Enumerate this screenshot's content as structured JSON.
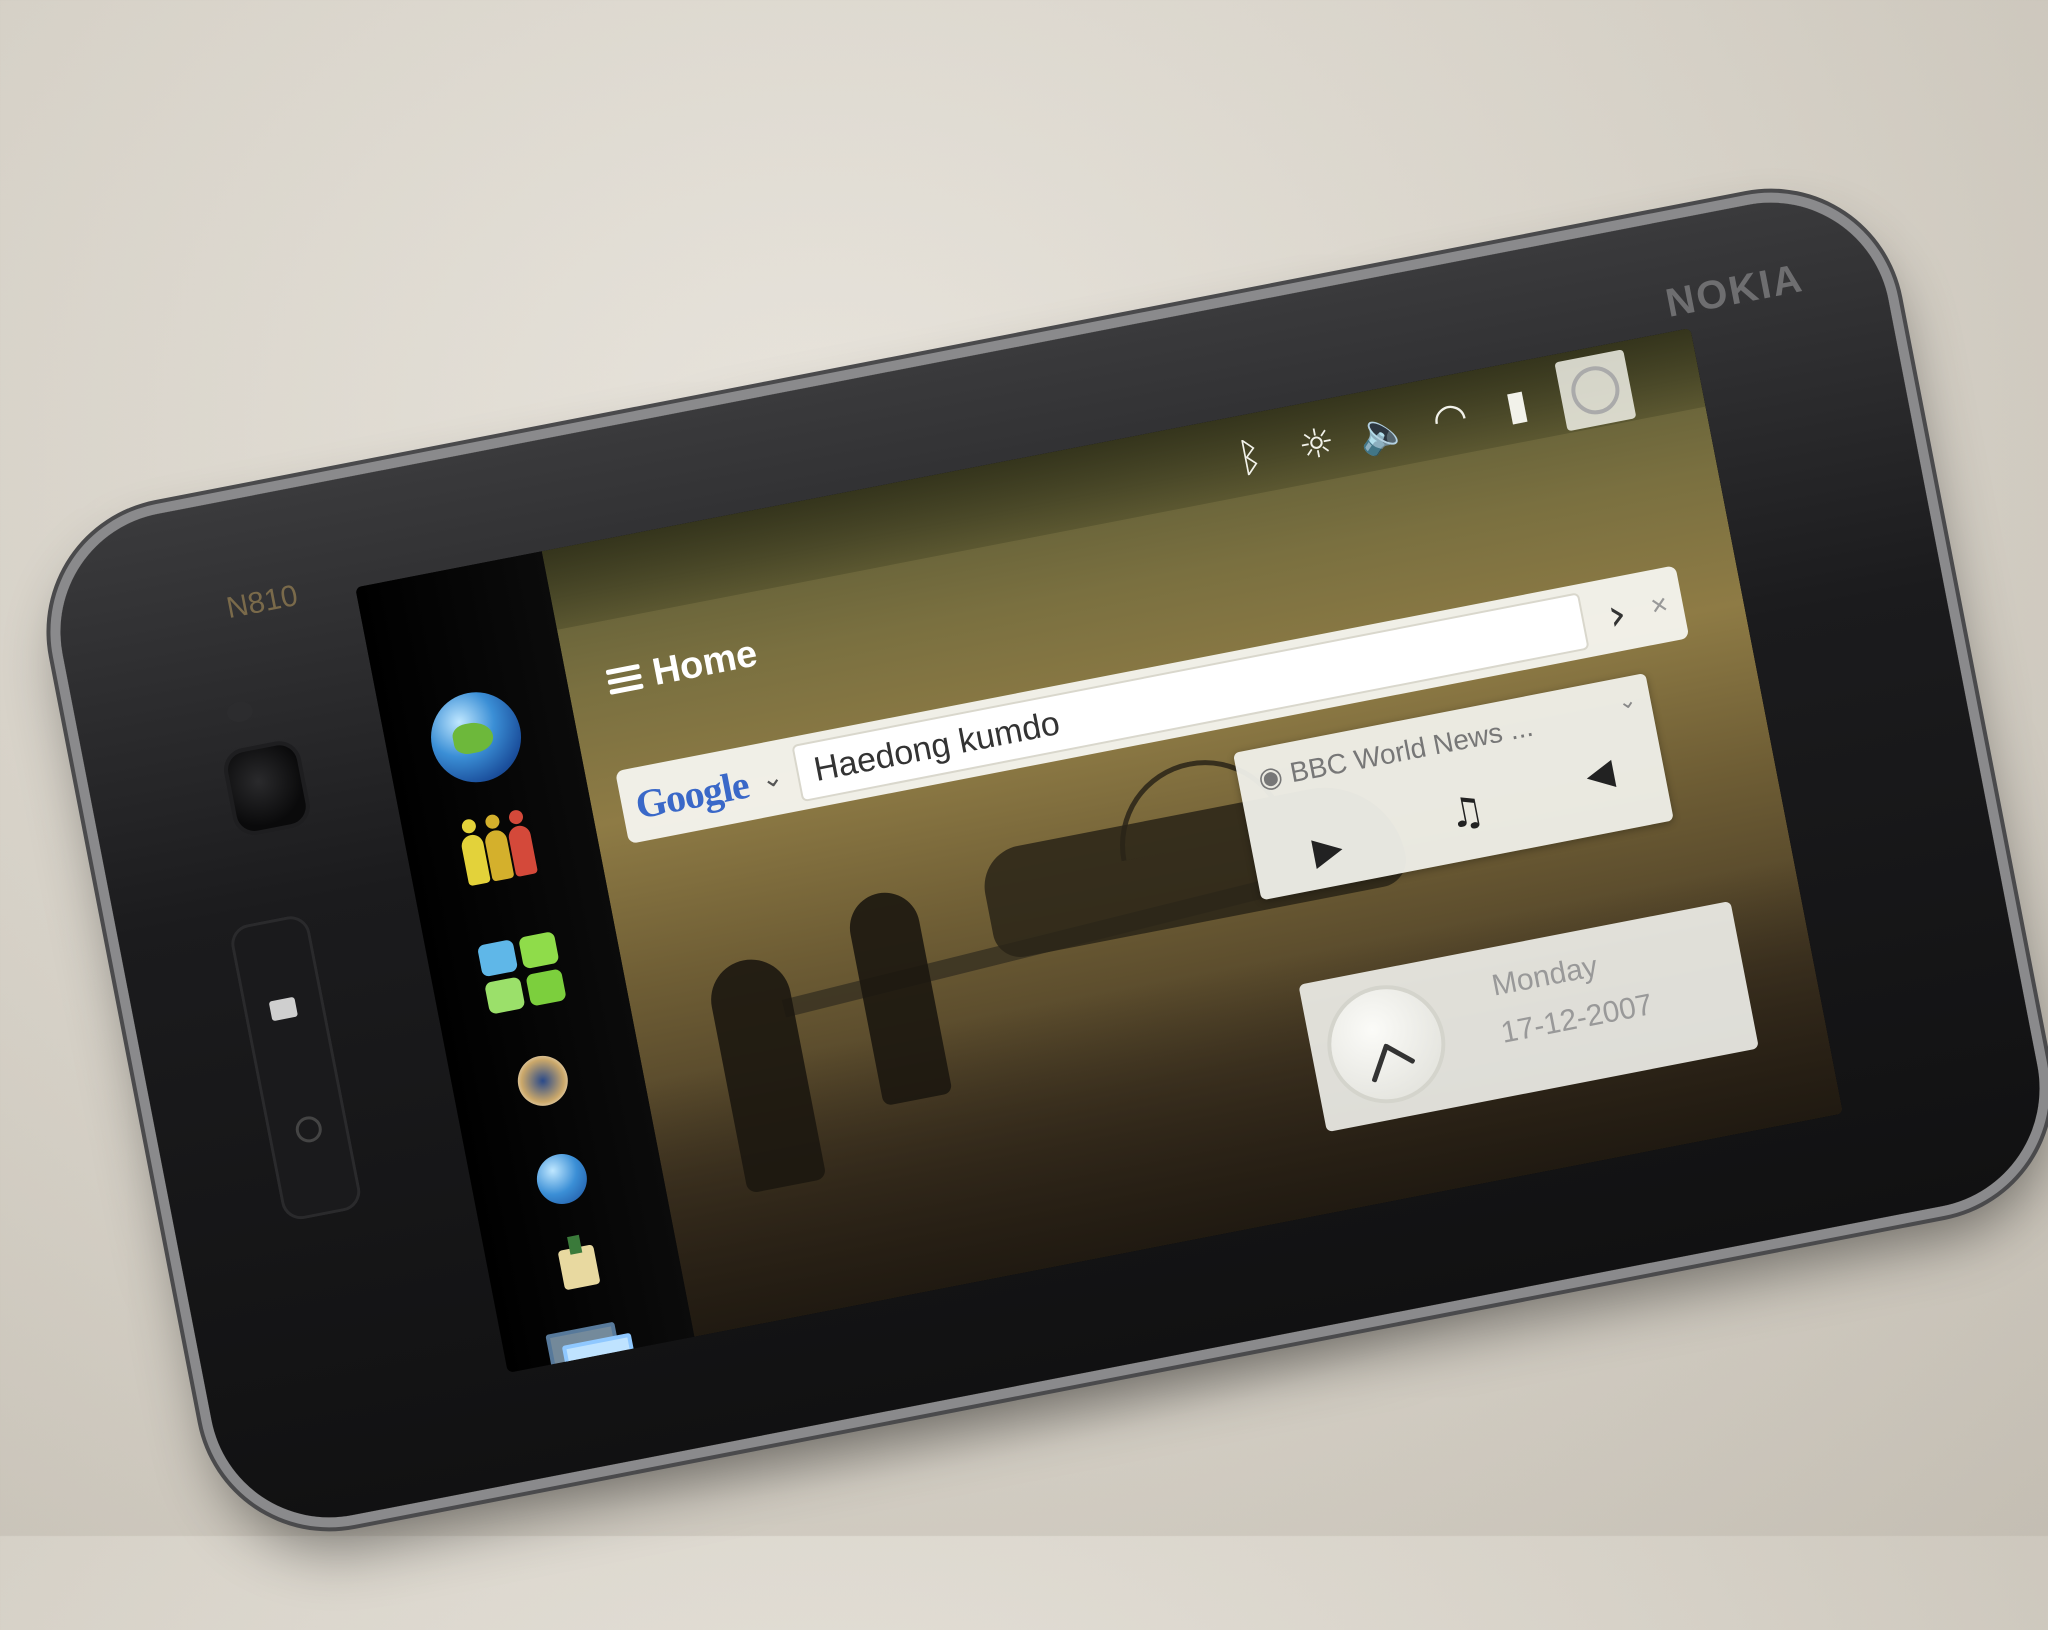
{
  "device": {
    "brand": "NOKIA",
    "model": "N810"
  },
  "header": {
    "title": "Home"
  },
  "status_icons": [
    "bluetooth-icon",
    "brightness-icon",
    "volume-icon",
    "wifi-icon",
    "battery-icon",
    "clock-icon"
  ],
  "search": {
    "provider": "Google",
    "query": "Haedong kumdo",
    "go_label": "›"
  },
  "radio_widget": {
    "station": "BBC World News ..."
  },
  "date_widget": {
    "day": "Monday",
    "date": "17-12-2007"
  },
  "sidebar": {
    "items": [
      "web-browser-icon",
      "contacts-icon",
      "applications-icon",
      "media-icon",
      "globe-small-icon",
      "settings-icon",
      "task-switcher-icon"
    ]
  },
  "colors": {
    "accent": "#3b8fd6",
    "screen_bg": "#050505",
    "wallpaper": "#8e7b45"
  }
}
